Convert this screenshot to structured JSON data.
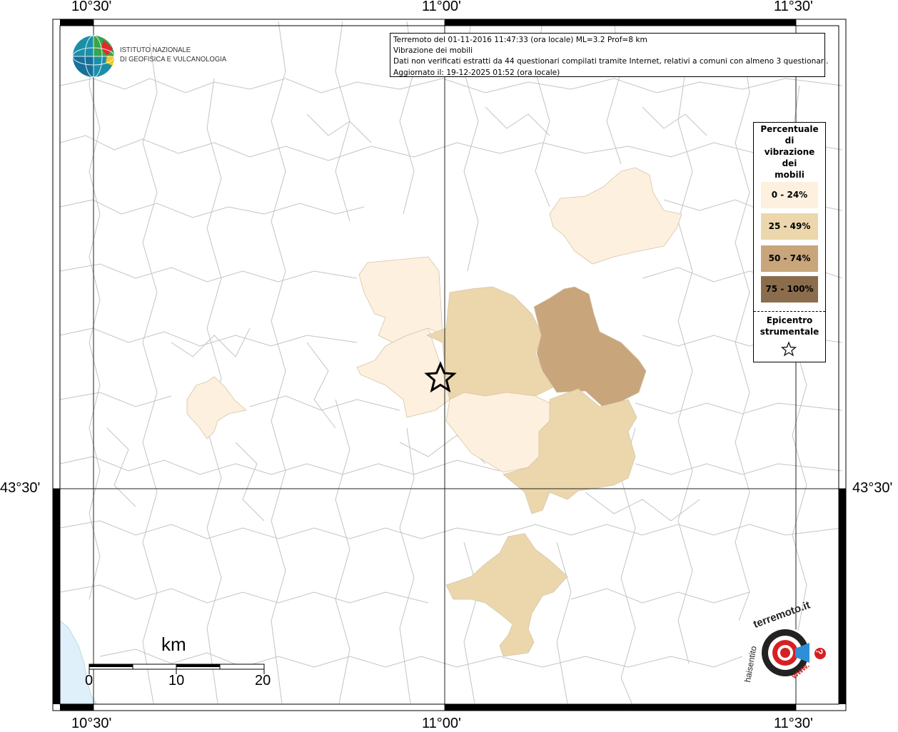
{
  "coordinates": {
    "top_left_lon": "10°30'",
    "top_center_lon": "11°00'",
    "top_right_lon": "11°30'",
    "bottom_left_lon": "10°30'",
    "bottom_center_lon": "11°00'",
    "bottom_right_lon": "11°30'",
    "left_lat": "43°30'",
    "right_lat": "43°30'"
  },
  "info": {
    "line1": "Terremoto del 01-11-2016 11:47:33 (ora locale) ML=3.2 Prof=8 km",
    "line2": "Vibrazione dei mobili",
    "line3": "Dati non verificati estratti da 44 questionari compilati tramite Internet, relativi a comuni con almeno 3 questionari.",
    "line4": "Aggiornato il: 19-12-2025 01:52 (ora locale)"
  },
  "logo": {
    "line1": "ISTITUTO NAZIONALE",
    "line2": "DI GEOFISICA E VULCANOLOGIA"
  },
  "legend": {
    "title_line1": "Percentuale",
    "title_line2": "di",
    "title_line3": "vibrazione",
    "title_line4": "dei",
    "title_line5": "mobili",
    "items": [
      {
        "label": "0 - 24%",
        "color": "#fdf0de"
      },
      {
        "label": "25 - 49%",
        "color": "#ecd7ad"
      },
      {
        "label": "50 - 74%",
        "color": "#c8a57b"
      },
      {
        "label": "75 - 100%",
        "color": "#8b6d4d"
      }
    ],
    "epicenter_line1": "Epicentro",
    "epicenter_line2": "strumentale"
  },
  "scale": {
    "unit": "km",
    "ticks": [
      "0",
      "10",
      "20"
    ]
  },
  "badge": {
    "top_text": "terremoto.it",
    "side_text": "haisentito",
    "bottom_text": "www.",
    "question_mark": "?"
  },
  "colors": {
    "light": "#fdf0de",
    "medium": "#ecd7ad",
    "dark": "#c8a57b",
    "sea": "#dff0fb",
    "border": "#c4c4c4"
  }
}
